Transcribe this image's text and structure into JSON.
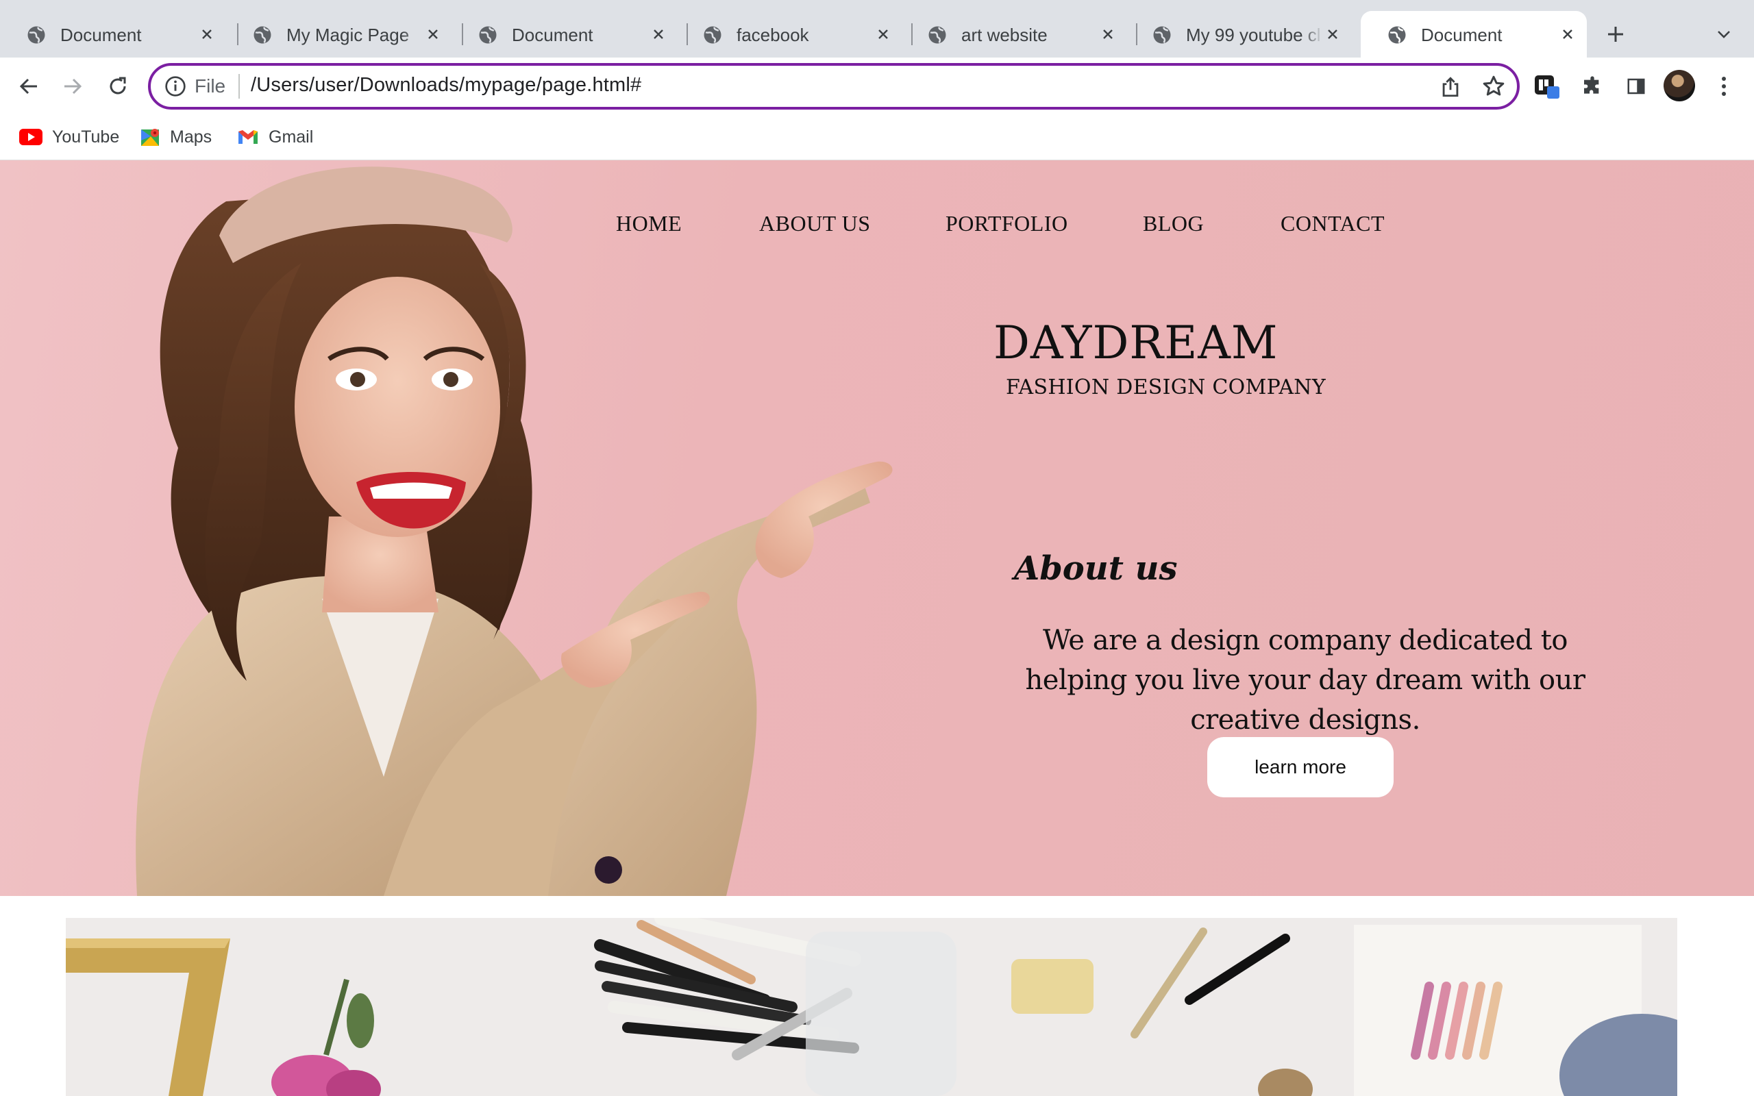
{
  "browser": {
    "tabs": [
      {
        "title": "Document",
        "active": false
      },
      {
        "title": "My Magic Page",
        "active": false
      },
      {
        "title": "Document",
        "active": false
      },
      {
        "title": "facebook",
        "active": false
      },
      {
        "title": "art website",
        "active": false
      },
      {
        "title": "My 99 youtube cl",
        "active": false
      },
      {
        "title": "Document",
        "active": true
      }
    ],
    "omnibox": {
      "scheme_label": "File",
      "url": "/Users/user/Downloads/mypage/page.html#"
    },
    "bookmarks": [
      {
        "label": "YouTube",
        "icon": "youtube-icon"
      },
      {
        "label": "Maps",
        "icon": "maps-icon"
      },
      {
        "label": "Gmail",
        "icon": "gmail-icon"
      }
    ],
    "colors": {
      "omnibox_focus": "#7b1fa2",
      "tabstrip": "#dee1e6"
    }
  },
  "page": {
    "nav": {
      "items": [
        "HOME",
        "ABOUT US",
        "PORTFOLIO",
        "BLOG",
        "CONTACT"
      ]
    },
    "hero": {
      "brand": "DAYDREAM",
      "tagline": "FASHION DESIGN COMPANY",
      "about_heading": "About us",
      "about_text": "We are a design company dedicated to helping you live your day dream with our creative designs.",
      "button_label": "learn more",
      "bg_color": "#ecb5b8"
    }
  }
}
